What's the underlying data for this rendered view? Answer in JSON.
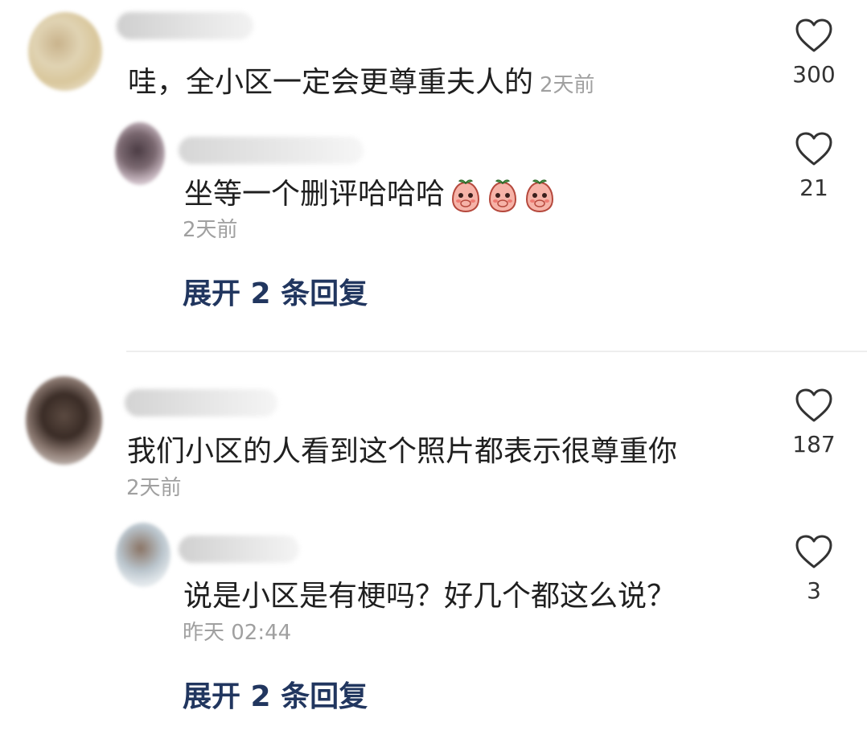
{
  "comments": [
    {
      "text": "哇，全小区一定会更尊重夫人的",
      "time": "2天前",
      "likes": "300",
      "reply": {
        "text": "坐等一个删评哈哈哈",
        "time": "2天前",
        "likes": "21",
        "emoji_count": 3,
        "emoji_icon": "peach-face-emoji-icon"
      },
      "expand_label": "展开 2 条回复"
    },
    {
      "text": "我们小区的人看到这个照片都表示很尊重你",
      "time": "2天前",
      "likes": "187",
      "reply": {
        "text": "说是小区是有梗吗？好几个都这么说？",
        "time": "昨天 02:44",
        "likes": "3"
      },
      "expand_label": "展开 2 条回复"
    }
  ],
  "colors": {
    "expand_text": "#21365f",
    "time_text": "#a0a0a0",
    "divider": "#eeeeee"
  }
}
